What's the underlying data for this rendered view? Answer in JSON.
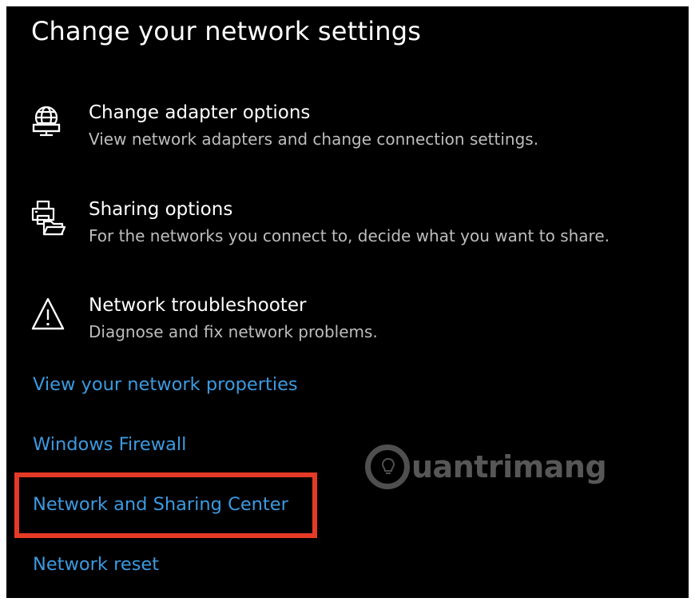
{
  "page": {
    "title": "Change your network settings"
  },
  "options": [
    {
      "icon": "globe-monitor-icon",
      "title": "Change adapter options",
      "description": "View network adapters and change connection settings."
    },
    {
      "icon": "printer-folder-icon",
      "title": "Sharing options",
      "description": "For the networks you connect to, decide what you want to share."
    },
    {
      "icon": "warning-triangle-icon",
      "title": "Network troubleshooter",
      "description": "Diagnose and fix network problems."
    }
  ],
  "links": [
    {
      "label": "View your network properties"
    },
    {
      "label": "Windows Firewall"
    },
    {
      "label": "Network and Sharing Center",
      "highlighted": true
    },
    {
      "label": "Network reset"
    }
  ],
  "watermark": {
    "text": "uantrimang"
  },
  "colors": {
    "background": "#000000",
    "link": "#3c9ae0",
    "description": "#bdbdbd",
    "highlight": "#e53a27"
  }
}
